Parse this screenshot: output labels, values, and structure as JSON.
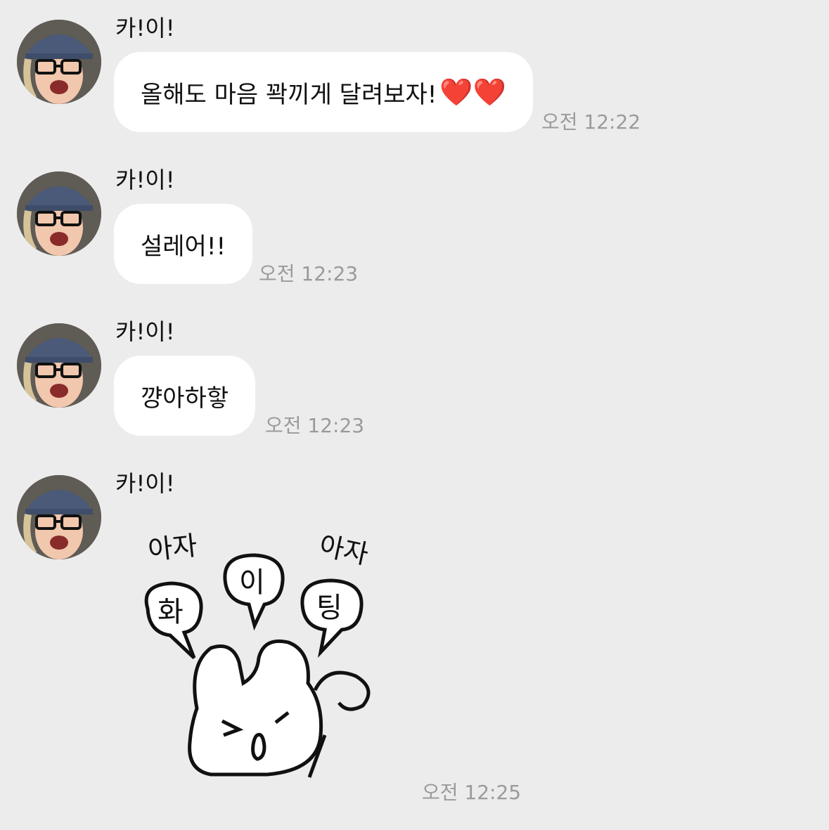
{
  "messages": [
    {
      "sender": "카!이!",
      "text": "올해도 마음 꽉끼게 달려보자!",
      "hearts": "❤️❤️",
      "time": "오전 12:22"
    },
    {
      "sender": "카!이!",
      "text": "설레어!!",
      "time": "오전 12:23"
    },
    {
      "sender": "카!이!",
      "text": "꺙아하핳",
      "time": "오전 12:23"
    },
    {
      "sender": "카!이!",
      "time": "오전 12:25",
      "sticker": {
        "words": [
          "아자",
          "아자",
          "화",
          "이",
          "팅"
        ],
        "icon": "bunny-sticker"
      }
    }
  ],
  "colors": {
    "background": "#ececec",
    "bubble": "#ffffff",
    "time": "#9a9a9a"
  }
}
